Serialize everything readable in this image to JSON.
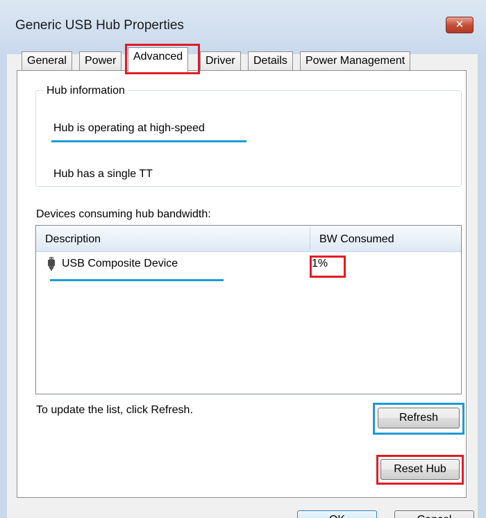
{
  "window": {
    "title": "Generic USB Hub Properties",
    "close_glyph": "✕"
  },
  "tabs": [
    {
      "label": "General",
      "active": false
    },
    {
      "label": "Power",
      "active": false
    },
    {
      "label": "Advanced",
      "active": true
    },
    {
      "label": "Driver",
      "active": false
    },
    {
      "label": "Details",
      "active": false
    },
    {
      "label": "Power Management",
      "active": false
    }
  ],
  "hub_info": {
    "legend": "Hub information",
    "line1": "Hub is operating at high-speed",
    "line2": "Hub has a single TT"
  },
  "devices": {
    "label": "Devices consuming hub bandwidth:",
    "columns": [
      "Description",
      "BW Consumed"
    ],
    "rows": [
      {
        "description": "USB Composite Device",
        "bw": "1%",
        "icon": "usb-plug-icon"
      }
    ]
  },
  "hint": "To update the list, click Refresh.",
  "buttons": {
    "refresh": "Refresh",
    "reset_hub": "Reset Hub",
    "ok": "OK",
    "cancel": "Cancel"
  },
  "colors": {
    "highlight_red": "#e01b24",
    "highlight_blue": "#1a9bd7"
  }
}
